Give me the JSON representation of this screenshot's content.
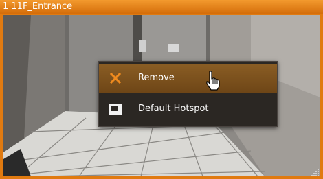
{
  "window": {
    "title": "1 11F_Entrance"
  },
  "context_menu": {
    "items": [
      {
        "label": "Remove",
        "icon": "close-x-icon",
        "highlighted": true
      },
      {
        "label": "Default Hotspot",
        "icon": "hotspot-icon",
        "highlighted": false
      }
    ]
  },
  "colors": {
    "title_bar": "#e07a10",
    "menu_background": "#2b2723",
    "menu_highlight": "#7a5020",
    "remove_icon": "#e8801a"
  }
}
